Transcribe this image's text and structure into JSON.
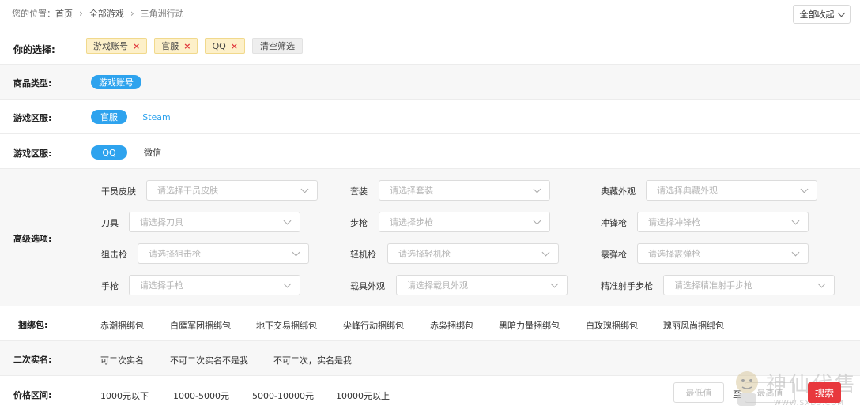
{
  "breadcrumb": {
    "prefix": "您的位置：",
    "items": [
      "首页",
      "全部游戏",
      "三角洲行动"
    ]
  },
  "collapse_all": "全部收起",
  "selection": {
    "label": "你的选择:",
    "chips": [
      "游戏账号",
      "官服",
      "QQ"
    ],
    "remove_icon": "×",
    "clear_label": "清空筛选"
  },
  "product_type": {
    "label": "商品类型:",
    "options": [
      "游戏账号"
    ]
  },
  "server_region": {
    "label": "游戏区服:",
    "options": [
      "官服",
      "Steam"
    ]
  },
  "login_region": {
    "label": "游戏区服:",
    "options": [
      "QQ",
      "微信"
    ]
  },
  "advanced": {
    "label": "高级选项:",
    "fields": [
      {
        "label": "干员皮肤",
        "placeholder": "请选择干员皮肤"
      },
      {
        "label": "套装",
        "placeholder": "请选择套装"
      },
      {
        "label": "典藏外观",
        "placeholder": "请选择典藏外观"
      },
      {
        "label": "刀具",
        "placeholder": "请选择刀具"
      },
      {
        "label": "步枪",
        "placeholder": "请选择步枪"
      },
      {
        "label": "冲锋枪",
        "placeholder": "请选择冲锋枪"
      },
      {
        "label": "狙击枪",
        "placeholder": "请选择狙击枪"
      },
      {
        "label": "轻机枪",
        "placeholder": "请选择轻机枪"
      },
      {
        "label": "霰弹枪",
        "placeholder": "请选择霰弹枪"
      },
      {
        "label": "手枪",
        "placeholder": "请选择手枪"
      },
      {
        "label": "载具外观",
        "placeholder": "请选择载具外观"
      },
      {
        "label": "精准射手步枪",
        "placeholder": "请选择精准射手步枪"
      }
    ]
  },
  "bundle": {
    "label": "捆绑包:",
    "options": [
      "赤潮捆绑包",
      "白鹰军团捆绑包",
      "地下交易捆绑包",
      "尖峰行动捆绑包",
      "赤枭捆绑包",
      "黑暗力量捆绑包",
      "白玫瑰捆绑包",
      "瑰丽风尚捆绑包"
    ]
  },
  "real_name": {
    "label": "二次实名:",
    "options": [
      "可二次实名",
      "不可二次实名不是我",
      "不可二次，实名是我"
    ]
  },
  "price": {
    "label": "价格区间:",
    "options": [
      "1000元以下",
      "1000-5000元",
      "5000-10000元",
      "10000元以上"
    ],
    "min_placeholder": "最低值",
    "to": "至",
    "max_placeholder": "最高值",
    "search": "搜索"
  },
  "watermark": {
    "text": "神仙代售",
    "url": "WWW.SXDS.COM"
  },
  "colors": {
    "accent": "#2ea3ee",
    "chip_bg": "#fdf0c9",
    "search": "#e8383d"
  }
}
